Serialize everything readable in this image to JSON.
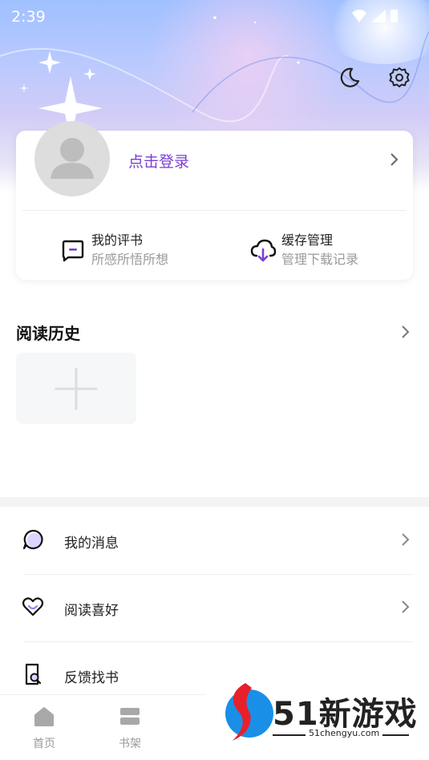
{
  "status_bar": {
    "time": "2:39"
  },
  "header": {
    "night_mode_icon": "moon-icon",
    "settings_icon": "gear-icon"
  },
  "profile": {
    "login_label": "点击登录"
  },
  "quick_actions": [
    {
      "title": "我的评书",
      "subtitle": "所感所悟所想",
      "icon": "comment-icon"
    },
    {
      "title": "缓存管理",
      "subtitle": "管理下载记录",
      "icon": "cloud-download-icon"
    }
  ],
  "history": {
    "title": "阅读历史"
  },
  "menu": [
    {
      "label": "我的消息",
      "icon": "message-icon"
    },
    {
      "label": "阅读喜好",
      "icon": "heart-icon"
    },
    {
      "label": "反馈找书",
      "icon": "search-book-icon"
    }
  ],
  "tabs": [
    {
      "label": "首页",
      "icon": "home-icon"
    },
    {
      "label": "书架",
      "icon": "bookshelf-icon"
    }
  ],
  "watermark": {
    "text": "51新游戏",
    "url": "51chengyu.com"
  },
  "colors": {
    "accent": "#7a3fd0",
    "muted": "#9a9a9a"
  }
}
